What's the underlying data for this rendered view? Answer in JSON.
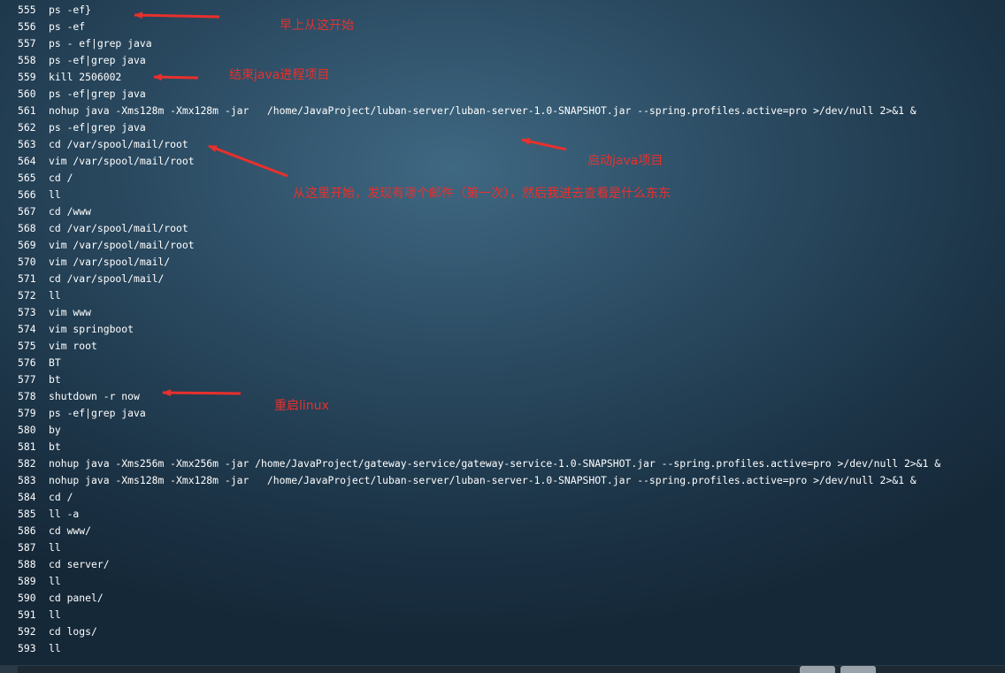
{
  "history": [
    {
      "n": "555",
      "cmd": "ps -ef}"
    },
    {
      "n": "556",
      "cmd": "ps -ef"
    },
    {
      "n": "557",
      "cmd": "ps - ef|grep java"
    },
    {
      "n": "558",
      "cmd": "ps -ef|grep java"
    },
    {
      "n": "559",
      "cmd": "kill 2506002"
    },
    {
      "n": "560",
      "cmd": "ps -ef|grep java"
    },
    {
      "n": "561",
      "cmd": "nohup java -Xms128m -Xmx128m -jar   /home/JavaProject/luban-server/luban-server-1.0-SNAPSHOT.jar --spring.profiles.active=pro >/dev/null 2>&1 &"
    },
    {
      "n": "562",
      "cmd": "ps -ef|grep java"
    },
    {
      "n": "563",
      "cmd": "cd /var/spool/mail/root"
    },
    {
      "n": "564",
      "cmd": "vim /var/spool/mail/root"
    },
    {
      "n": "565",
      "cmd": "cd /"
    },
    {
      "n": "566",
      "cmd": "ll"
    },
    {
      "n": "567",
      "cmd": "cd /www"
    },
    {
      "n": "568",
      "cmd": "cd /var/spool/mail/root"
    },
    {
      "n": "569",
      "cmd": "vim /var/spool/mail/root"
    },
    {
      "n": "570",
      "cmd": "vim /var/spool/mail/"
    },
    {
      "n": "571",
      "cmd": "cd /var/spool/mail/"
    },
    {
      "n": "572",
      "cmd": "ll"
    },
    {
      "n": "573",
      "cmd": "vim www"
    },
    {
      "n": "574",
      "cmd": "vim springboot"
    },
    {
      "n": "575",
      "cmd": "vim root"
    },
    {
      "n": "576",
      "cmd": "BT"
    },
    {
      "n": "577",
      "cmd": "bt"
    },
    {
      "n": "578",
      "cmd": "shutdown -r now"
    },
    {
      "n": "579",
      "cmd": "ps -ef|grep java"
    },
    {
      "n": "580",
      "cmd": "by"
    },
    {
      "n": "581",
      "cmd": "bt"
    },
    {
      "n": "582",
      "cmd": "nohup java -Xms256m -Xmx256m -jar /home/JavaProject/gateway-service/gateway-service-1.0-SNAPSHOT.jar --spring.profiles.active=pro >/dev/null 2>&1 &"
    },
    {
      "n": "583",
      "cmd": "nohup java -Xms128m -Xmx128m -jar   /home/JavaProject/luban-server/luban-server-1.0-SNAPSHOT.jar --spring.profiles.active=pro >/dev/null 2>&1 &"
    },
    {
      "n": "584",
      "cmd": "cd /"
    },
    {
      "n": "585",
      "cmd": "ll -a"
    },
    {
      "n": "586",
      "cmd": "cd www/"
    },
    {
      "n": "587",
      "cmd": "ll"
    },
    {
      "n": "588",
      "cmd": "cd server/"
    },
    {
      "n": "589",
      "cmd": "ll"
    },
    {
      "n": "590",
      "cmd": "cd panel/"
    },
    {
      "n": "591",
      "cmd": "ll"
    },
    {
      "n": "592",
      "cmd": "cd logs/"
    },
    {
      "n": "593",
      "cmd": "ll"
    }
  ],
  "annotations": {
    "morning_start": "早上从这开始",
    "kill_java": "结束java进程项目",
    "start_java": "启动java项目",
    "mail_found": "从这里开始，发现有哪个邮件（第一次），然后我进去查看是什么东东",
    "reboot": "重启linux"
  },
  "colors": {
    "annotation": "#e8302c",
    "text": "#ffffff"
  }
}
